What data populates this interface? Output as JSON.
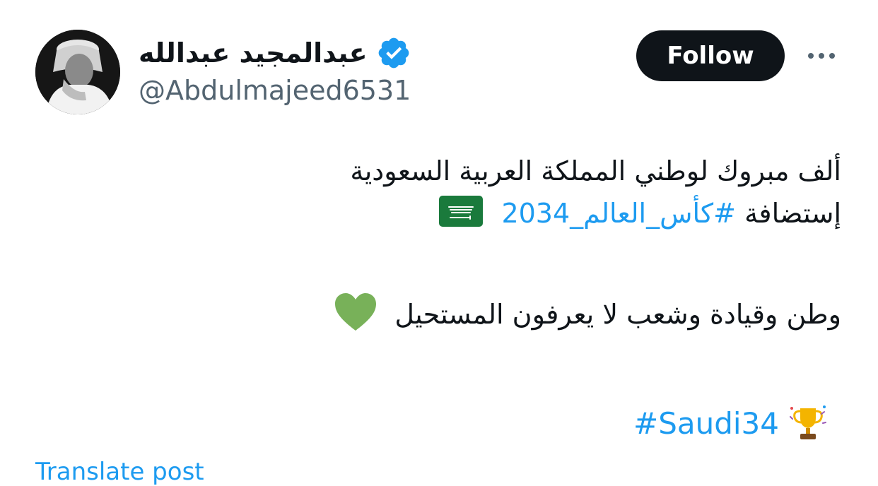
{
  "author": {
    "display_name": "عبدالمجيد عبدالله",
    "handle": "@Abdulmajeed6531",
    "verified_icon": "verified-badge-icon",
    "avatar_icon": "profile-photo"
  },
  "actions": {
    "follow_label": "Follow",
    "more_icon": "more-options-icon"
  },
  "tweet": {
    "line1": "ألف مبروك لوطني المملكة العربية السعودية",
    "line2_text": "إستضافة ",
    "line2_hashtag": "#كأس_العالم_2034",
    "line2_emoji": "saudi-flag-icon",
    "line3": "وطن وقيادة وشعب لا يعرفون المستحيل",
    "line3_emoji": "green-heart-icon",
    "hashtag2": "#Saudi34",
    "hashtag2_emoji": "trophy-icon"
  },
  "footer": {
    "translate_label": "Translate post"
  },
  "colors": {
    "link": "#1d9bf0",
    "text": "#0f1419",
    "secondary": "#536471",
    "button_bg": "#0f1419",
    "verified": "#1d9bf0",
    "flag_green": "#1a7a3c",
    "heart_green": "#78b159"
  }
}
